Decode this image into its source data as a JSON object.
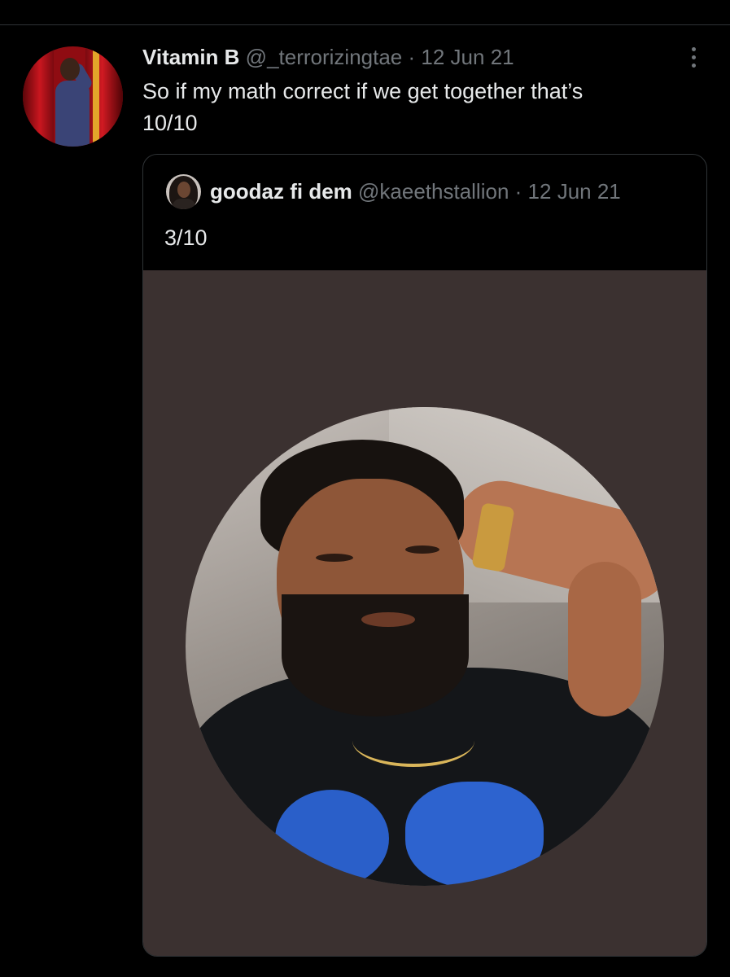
{
  "tweet": {
    "display_name": "Vitamin B",
    "handle": "@_terrorizingtae",
    "separator": "·",
    "timestamp": "12 Jun 21",
    "text_line1": "So if my math correct if we get together that’s",
    "text_line2": "10/10",
    "more_icon": "more-vertical-icon"
  },
  "quote": {
    "display_name": "goodaz fi dem",
    "handle": "@kaeethstallion",
    "separator": "·",
    "timestamp": "12 Jun 21",
    "text": "3/10"
  },
  "colors": {
    "background": "#000000",
    "text_primary": "#e7e9ea",
    "text_secondary": "#71767b",
    "border": "#2f3336",
    "media_background": "#3b3130"
  }
}
